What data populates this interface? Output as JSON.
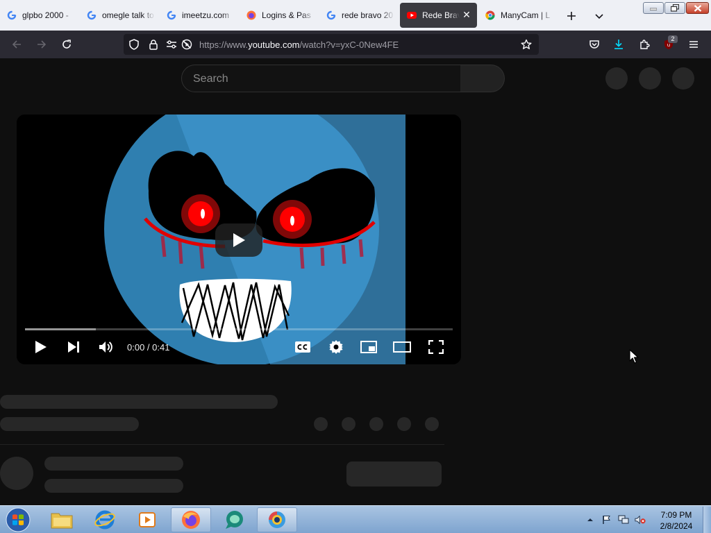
{
  "tabs": [
    {
      "title": "glpbo 2000 - ",
      "favicon": "google-icon"
    },
    {
      "title": "omegle talk to",
      "favicon": "google-icon"
    },
    {
      "title": "imeetzu.com",
      "favicon": "google-icon"
    },
    {
      "title": "Logins & Pas",
      "favicon": "firefox-icon"
    },
    {
      "title": "rede bravo 20",
      "favicon": "google-icon"
    },
    {
      "title": "Rede Bravo",
      "favicon": "youtube-icon",
      "active": true
    },
    {
      "title": "ManyCam | L",
      "favicon": "chrome-icon"
    }
  ],
  "address_bar": {
    "scheme": "https://www.",
    "host": "youtube.com",
    "path": "/watch?v=yxC-0New4FE"
  },
  "extensions": {
    "ublock_badge": "2"
  },
  "youtube": {
    "search_placeholder": "Search",
    "player": {
      "timecode": "0:00 / 0:41",
      "loaded_fraction": 0.165
    }
  },
  "taskbar": {
    "time": "7:09 PM",
    "date": "2/8/2024"
  },
  "colors": {
    "page_bg": "#0f0f0f",
    "skeleton": "#272727",
    "navbar": "#2b2a33",
    "active_tab": "#3a3a40"
  }
}
